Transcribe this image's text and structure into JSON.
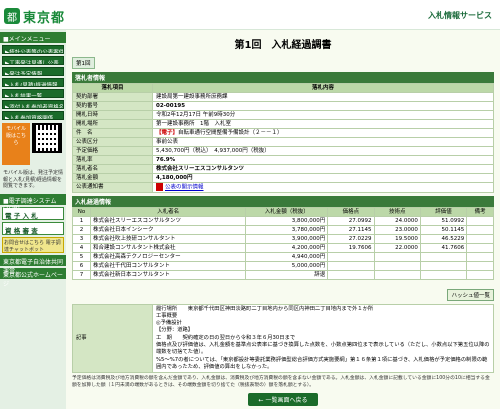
{
  "header": {
    "logo_text": "東京都",
    "logo_mark": "都",
    "service": "入札情報サービス"
  },
  "sidebar": {
    "head1": "■メインメニュー",
    "items": [
      "▶統計公表等の公表案件公告",
      "▶工事発注見通し公表",
      "▶発注予定情報",
      "▶入札(見積)経過情報",
      "▶入札結果一覧",
      "▶添付入札参加者資格名簿",
      "▶入札参加資格関係"
    ],
    "mobile_label": "モバイル版はこちら",
    "mobile_note": "モバイル版は、発注予定情報と入札(見積)経過情報を閲覧できます。",
    "head2": "■電子調達システム(TOP)",
    "big1": "電 子 入 札",
    "big2": "資 格 審 査",
    "yellow": "お問合せはこちら 電子調達チャットボット",
    "head3": "東京都電子自治体共同運営",
    "head4": "東京都公式ホームページ"
  },
  "page": {
    "title": "第1回　入札経過調書",
    "num_tag": "第1回"
  },
  "info": {
    "section": "落札者情報",
    "col1": "落札項目",
    "col2": "落札内容",
    "rows": [
      {
        "label": "契約部署",
        "value": "建設局第一建設事務所庶務課"
      },
      {
        "label": "契約番号",
        "value": "02-00195"
      },
      {
        "label": "開札日時",
        "value": "令和2年12月17日 午前9時30分"
      },
      {
        "label": "開札場所",
        "value": "第一建設事務所　1階　入札室"
      },
      {
        "label": "件　名",
        "prefix": "【電子】",
        "value": "自転車通行空間整備予備設計（２－－１）"
      },
      {
        "label": "公表区分",
        "value": "事前公表"
      },
      {
        "label": "予定価格",
        "value": "5,430,700円（税込）　4,937,000円（税抜）"
      },
      {
        "label": "落札率",
        "value": "76.9%"
      },
      {
        "label": "落札者名",
        "value": "株式会社スリーエスコンサルタンツ"
      },
      {
        "label": "落札金額",
        "value": "4,180,000円"
      },
      {
        "label": "公表通知書",
        "value": "公表の開示情報"
      }
    ]
  },
  "records": {
    "section": "入札経過情報",
    "headers": [
      "No",
      "入札者名",
      "入札金額（税抜）",
      "価格点",
      "技術点",
      "評価値",
      "備考"
    ],
    "rows": [
      [
        "1",
        "株式会社スリーエスコンサルタンツ",
        "3,800,000円",
        "27.0992",
        "24.0000",
        "51.0992",
        ""
      ],
      [
        "2",
        "株式会社日本インシーク",
        "3,780,000円",
        "27.1145",
        "23.0000",
        "50.1145",
        ""
      ],
      [
        "3",
        "株式会社吹上技研コンサルタント",
        "3,900,000円",
        "27.0229",
        "19.5000",
        "46.5229",
        ""
      ],
      [
        "4",
        "和合建設コンサルタント株式会社",
        "4,200,000円",
        "19.7606",
        "22.0000",
        "41.7606",
        ""
      ],
      [
        "5",
        "株式会社高森テクノロジーセンター",
        "4,940,000円",
        "",
        "",
        "",
        ""
      ],
      [
        "6",
        "株式会社千代田コンサルタント",
        "5,000,000円",
        "",
        "",
        "",
        ""
      ],
      [
        "7",
        "株式会社新日本コンサルタント",
        "辞退",
        "",
        "",
        "",
        ""
      ]
    ],
    "history_button": "ハッシュ値一覧"
  },
  "remarks": {
    "label": "記事",
    "lines": [
      "履行場所　　東京都千代田区神田淡路町二丁目地内から同区内神田二丁目地内まで外１か所",
      "工事概要",
      "◎予備設計",
      "【分野：道路】",
      "工　期　　契約確定の日の翌日から令和３年６月30日まで",
      "価格点及び評価値は、入札金額を基準点公表率に基づき換算した点数を、小数点第四位まで表示している（ただし、小数点以下第五位以降の端数を切捨てた値）。",
      "%5〜%7の者については、「東京都設計等委託業務評価型総合評価方式実施要綱」第１６条第１項に基づき、入札価格が予定価格の制限の範囲内であったため、評価値の算出をしなかった。"
    ]
  },
  "footer": {
    "note": "予定価格は消費税及び地方消費税の額を含んだ金額であり、入札金額は、消費税及び地方消費税の額を含まない金額である。入札金額は、入札金額に記載している金額に100分の10に相当する金額を加算した額（１円未満の端数があるときは、その端数金額を切り捨てた（税抜表現の）額を落札額とする）。",
    "back_button": "← 一覧画面へ戻る"
  }
}
